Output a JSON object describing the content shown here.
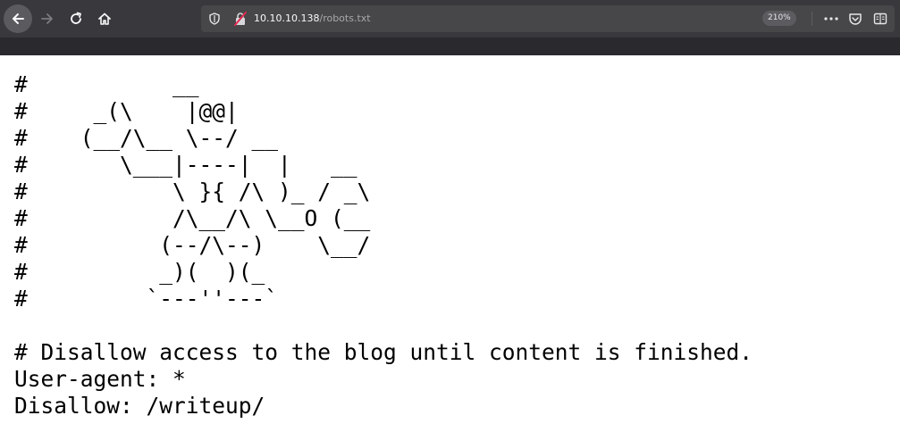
{
  "browser": {
    "url_host": "10.10.10.138",
    "url_path": "/robots.txt",
    "zoom": "210%",
    "icons": {
      "back": "arrow-left-icon",
      "forward": "arrow-right-icon",
      "reload": "reload-icon",
      "home": "home-icon",
      "shield": "shield-icon",
      "insecure": "insecure-lock-icon",
      "more": "more-dots-icon",
      "pocket": "pocket-icon",
      "reader": "reader-view-icon"
    },
    "colors": {
      "toolbar": "#38383d",
      "urlbar": "#474749",
      "insecure_slash": "#e22850"
    }
  },
  "document": {
    "lines": [
      "#           __",
      "#     _(\\    |@@|",
      "#    (__/\\__ \\--/ __",
      "#       \\___|----|  |   __",
      "#           \\ }{ /\\ )_ / _\\",
      "#           /\\__/\\ \\__O (__",
      "#          (--/\\--)    \\__/",
      "#          _)(  )(_",
      "#         `---''---`",
      "",
      "# Disallow access to the blog until content is finished.",
      "User-agent: *",
      "Disallow: /writeup/"
    ]
  }
}
